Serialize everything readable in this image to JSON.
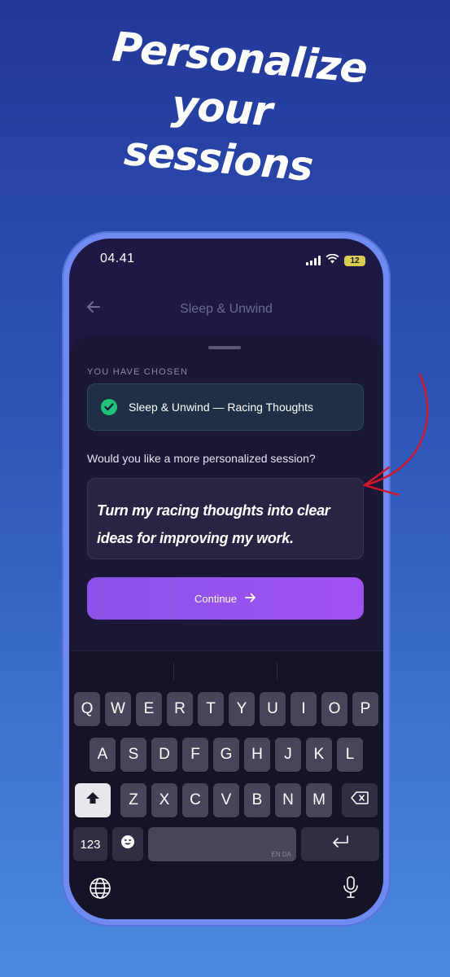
{
  "headline": {
    "line1": "Personalize",
    "line2": "your",
    "line3": "sessions"
  },
  "status": {
    "time": "04.41",
    "battery": "12"
  },
  "nav": {
    "title": "Sleep & Unwind"
  },
  "sheet": {
    "chosen_label": "YOU HAVE CHOSEN",
    "chosen_value": "Sleep & Unwind — Racing Thoughts",
    "question": "Would you like a more personalized session?",
    "prompt_text": "Turn my racing thoughts into clear ideas for improving my work.",
    "continue_label": "Continue"
  },
  "keyboard": {
    "row1": [
      "Q",
      "W",
      "E",
      "R",
      "T",
      "Y",
      "U",
      "I",
      "O",
      "P"
    ],
    "row2": [
      "A",
      "S",
      "D",
      "F",
      "G",
      "H",
      "J",
      "K",
      "L"
    ],
    "row3": [
      "Z",
      "X",
      "C",
      "V",
      "B",
      "N",
      "M"
    ],
    "num_label": "123",
    "space_lang": "EN DA"
  },
  "colors": {
    "accent": "#9a52ee",
    "check": "#22c27a",
    "arrow": "#d4162a",
    "frame": "#6f8bf2"
  },
  "icons": {
    "back": "arrow-left-icon",
    "check": "check-circle-icon",
    "continue": "arrow-right-icon",
    "shift": "shift-icon",
    "delete": "backspace-icon",
    "return": "return-icon",
    "emoji": "emoji-icon",
    "globe": "globe-icon",
    "mic": "microphone-icon"
  }
}
